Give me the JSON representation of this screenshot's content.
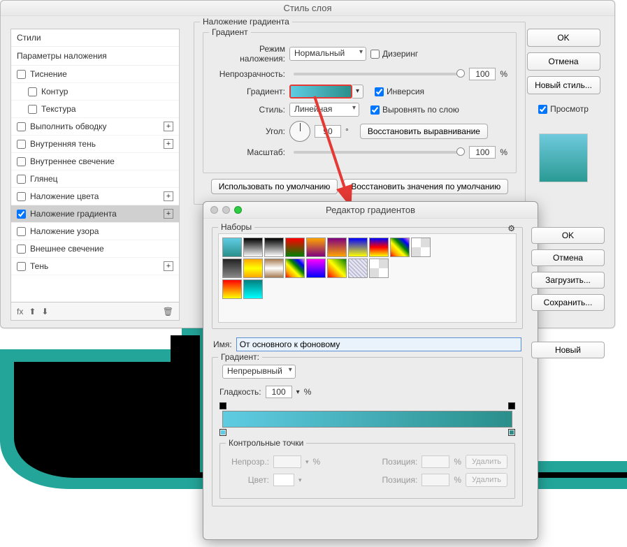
{
  "main": {
    "title": "Стиль слоя",
    "styles_heading": "Стили",
    "params_label": "Параметры наложения",
    "items": [
      {
        "label": "Тиснение",
        "checked": false,
        "plus": false,
        "indent": false
      },
      {
        "label": "Контур",
        "checked": false,
        "plus": false,
        "indent": true
      },
      {
        "label": "Текстура",
        "checked": false,
        "plus": false,
        "indent": true
      },
      {
        "label": "Выполнить обводку",
        "checked": false,
        "plus": true,
        "indent": false
      },
      {
        "label": "Внутренняя тень",
        "checked": false,
        "plus": true,
        "indent": false
      },
      {
        "label": "Внутреннее свечение",
        "checked": false,
        "plus": false,
        "indent": false
      },
      {
        "label": "Глянец",
        "checked": false,
        "plus": false,
        "indent": false
      },
      {
        "label": "Наложение цвета",
        "checked": false,
        "plus": true,
        "indent": false
      },
      {
        "label": "Наложение градиента",
        "checked": true,
        "plus": true,
        "indent": false,
        "selected": true
      },
      {
        "label": "Наложение узора",
        "checked": false,
        "plus": false,
        "indent": false
      },
      {
        "label": "Внешнее свечение",
        "checked": false,
        "plus": false,
        "indent": false
      },
      {
        "label": "Тень",
        "checked": false,
        "plus": true,
        "indent": false
      }
    ],
    "fx_label": "fx",
    "grad_overlay_legend": "Наложение градиента",
    "gradient_legend": "Градиент",
    "blend_label": "Режим наложения:",
    "blend_value": "Нормальный",
    "dither_label": "Дизеринг",
    "opacity_label": "Непрозрачность:",
    "opacity_value": "100",
    "pct": "%",
    "gradient_label": "Градиент:",
    "invert_label": "Инверсия",
    "style_label": "Стиль:",
    "style_value": "Линейная",
    "align_label": "Выровнять по слою",
    "angle_label": "Угол:",
    "angle_value": "90",
    "deg": "°",
    "reset_align": "Восстановить выравнивание",
    "scale_label": "Масштаб:",
    "scale_value": "100",
    "use_default": "Использовать по умолчанию",
    "restore_default": "Восстановить значения по умолчанию",
    "ok": "OK",
    "cancel": "Отмена",
    "new_style": "Новый стиль...",
    "preview": "Просмотр"
  },
  "ge": {
    "title": "Редактор градиентов",
    "presets_legend": "Наборы",
    "ok": "OK",
    "cancel": "Отмена",
    "load": "Загрузить...",
    "save": "Сохранить...",
    "new": "Новый",
    "name_label": "Имя:",
    "name_value": "От основного к фоновому",
    "gradient_label": "Градиент:",
    "gradient_type": "Непрерывный",
    "smooth_label": "Гладкость:",
    "smooth_value": "100",
    "pct": "%",
    "ctrl_legend": "Контрольные точки",
    "opac_label": "Непрозр.:",
    "pos_label": "Позиция:",
    "delete": "Удалить",
    "color_label": "Цвет:"
  }
}
